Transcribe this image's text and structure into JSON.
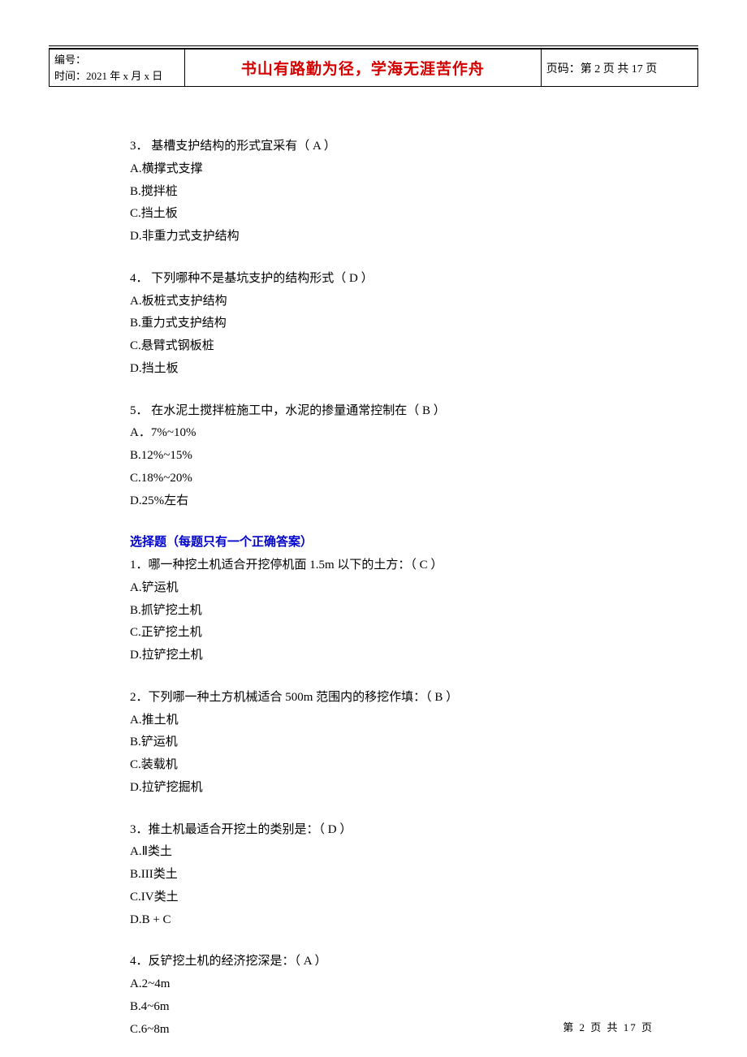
{
  "header": {
    "id_label": "编号：",
    "date_label": "时间：2021 年 x 月 x 日",
    "motto": "书山有路勤为径，学海无涯苦作舟",
    "page_label": "页码：第 2 页  共 17 页"
  },
  "questions_a": [
    {
      "stem": "3．  基槽支护结构的形式宜采有（ A ）",
      "opts": [
        "A.横撑式支撑",
        "B.搅拌桩",
        "C.挡土板",
        "D.非重力式支护结构"
      ]
    },
    {
      "stem": "4．  下列哪种不是基坑支护的结构形式（ D ）",
      "opts": [
        "A.板桩式支护结构",
        "B.重力式支护结构",
        "C.悬臂式钢板桩",
        "D.挡土板"
      ]
    },
    {
      "stem": "5．  在水泥土搅拌桩施工中，水泥的掺量通常控制在（ B ）",
      "opts": [
        "A．7%~10%",
        "B.12%~15%",
        "C.18%~20%",
        "D.25%左右"
      ]
    }
  ],
  "section_heading": "选择题（每题只有一个正确答案）",
  "questions_b": [
    {
      "stem": "1．哪一种挖土机适合开挖停机面 1.5m 以下的土方：（ C ）",
      "opts": [
        "A.铲运机",
        "B.抓铲挖土机",
        "C.正铲挖土机",
        "D.拉铲挖土机"
      ]
    },
    {
      "stem": "2．下列哪一种土方机械适合 500m 范围内的移挖作填：（ B ）",
      "opts": [
        "A.推土机",
        "B.铲运机",
        "C.装载机",
        "D.拉铲挖掘机"
      ]
    },
    {
      "stem": "3．推土机最适合开挖土的类别是：（ D ）",
      "opts": [
        "A.Ⅱ类土",
        "B.III类土",
        "C.IV类土",
        "D.B + C"
      ]
    },
    {
      "stem": "4．反铲挖土机的经济挖深是：（ A ）",
      "opts": [
        "A.2~4m",
        "B.4~6m",
        "C.6~8m"
      ]
    }
  ],
  "footer": {
    "page_text": "第 2 页 共 17 页"
  }
}
